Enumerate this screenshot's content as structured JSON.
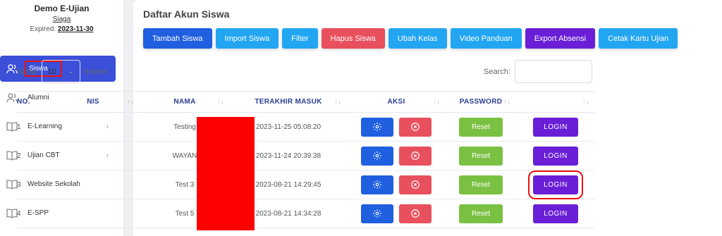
{
  "brand": {
    "title": "Demo E-Ujian",
    "subtitle": "Siaga",
    "expired_label": "Expired:",
    "expired_date": "2023-11-30"
  },
  "sidebar": {
    "items": [
      {
        "label": "Siswa",
        "icon": "users-icon",
        "active": true
      },
      {
        "label": "Alumni",
        "icon": "users-icon"
      },
      {
        "label": "E-Learning",
        "icon": "book-icon",
        "chevron": "›"
      },
      {
        "label": "Ujian CBT",
        "icon": "book-icon",
        "chevron": "›"
      },
      {
        "label": "Website Sekolah",
        "icon": "book-icon"
      },
      {
        "label": "E-SPP",
        "icon": "book-icon"
      }
    ]
  },
  "page": {
    "title": "Daftar Akun Siswa"
  },
  "toolbar": {
    "buttons": [
      "Tambah Siswa",
      "Import Siswa",
      "Filter",
      "Hapus Siswa",
      "Ubah Kelas",
      "Video Panduan",
      "Export Absensi",
      "Cetak Kartu Ujian"
    ]
  },
  "entries": {
    "show_label": "Show",
    "value": "10",
    "entries_label": "entries"
  },
  "search": {
    "label": "Search:"
  },
  "table": {
    "headers": [
      "NO.",
      "NIS",
      "NAMA",
      "TERAKHIR MASUK",
      "AKSI",
      "PASSWORD"
    ],
    "reset_label": "Reset",
    "login_label": "LOGIN",
    "rows": [
      {
        "no": "1",
        "nama": "Testing",
        "terakhir": "2023-11-25 05:08:20"
      },
      {
        "no": "2",
        "nama": "WAYAN",
        "terakhir": "2023-11-24 20:39:38"
      },
      {
        "no": "3",
        "nama": "Test 3",
        "terakhir": "2023-08-21 14:29:45"
      },
      {
        "no": "4",
        "nama": "Test 5",
        "terakhir": "2023-08-21 14:34:28"
      }
    ]
  },
  "colors": {
    "primary": "#1f5fe0",
    "sky": "#22a6f2",
    "danger": "#e9505d",
    "purple": "#6a1fd6",
    "success": "#7ac143",
    "sidebar_active": "#3b4fd8",
    "highlight": "#ee1111"
  }
}
